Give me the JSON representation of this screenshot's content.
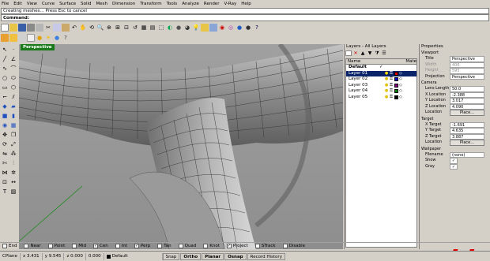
{
  "menu": [
    "File",
    "Edit",
    "View",
    "Curve",
    "Surface",
    "Solid",
    "Mesh",
    "Dimension",
    "Transform",
    "Tools",
    "Analyze",
    "Render",
    "V-Ray",
    "Help"
  ],
  "command": {
    "history": "Creating meshes... Press Esc to cancel",
    "prompt": "Command:"
  },
  "viewport": {
    "label": "Perspective",
    "overlay_number": "77"
  },
  "layers": {
    "title": "Layers - All Layers",
    "columns": {
      "name": "Name",
      "material": "Mate"
    },
    "items": [
      {
        "name": "Default",
        "current": true,
        "color": "#000000"
      },
      {
        "name": "Layer 01",
        "current": false,
        "color": "#e00000",
        "selected": true
      },
      {
        "name": "Layer 02",
        "current": false,
        "color": "#0000cc"
      },
      {
        "name": "Layer 03",
        "current": false,
        "color": "#800080"
      },
      {
        "name": "Layer 04",
        "current": false,
        "color": "#008000"
      },
      {
        "name": "Layer 05",
        "current": false,
        "color": "#000000"
      }
    ]
  },
  "properties": {
    "title": "Properties",
    "section_viewport": "Viewport",
    "title_label": "Title",
    "title_value": "Perspective",
    "width_label": "Width",
    "width_value": "406",
    "height_label": "Height",
    "height_value": "595",
    "projection_label": "Projection",
    "projection_value": "Perspective",
    "section_camera": "Camera",
    "lens_label": "Lens Length",
    "lens_value": "50.0",
    "xloc_label": "X Location",
    "xloc_value": "-2.388",
    "yloc_label": "Y Location",
    "yloc_value": "3.017",
    "zloc_label": "Z Location",
    "zloc_value": "4.090",
    "location_label": "Location",
    "place_label": "Place...",
    "section_target": "Target",
    "xt_label": "X Target",
    "xt_value": "-1.691",
    "yt_label": "Y Target",
    "yt_value": "4.635",
    "zt_label": "Z Target",
    "zt_value": "3.887",
    "tlocation_label": "Location",
    "tplace_label": "Place...",
    "section_wallpaper": "Wallpaper",
    "filename_label": "Filename",
    "filename_value": "(none)",
    "show_label": "Show",
    "gray_label": "Gray"
  },
  "osnap": [
    {
      "label": "End",
      "checked": false
    },
    {
      "label": "Near",
      "checked": false
    },
    {
      "label": "Point",
      "checked": false
    },
    {
      "label": "Mid",
      "checked": false
    },
    {
      "label": "Cen",
      "checked": true
    },
    {
      "label": "Int",
      "checked": false
    },
    {
      "label": "Perp",
      "checked": true
    },
    {
      "label": "Tan",
      "checked": false
    },
    {
      "label": "Quad",
      "checked": false
    },
    {
      "label": "Knot",
      "checked": false
    },
    {
      "label": "Project",
      "checked": true
    },
    {
      "label": "STrack",
      "checked": false
    },
    {
      "label": "Disable",
      "checked": false
    }
  ],
  "status": {
    "cplane": "CPlane",
    "x": "x 3.431",
    "y": "y 9.545",
    "z": "z 0.000",
    "dist": "0.000",
    "layer": "Default",
    "panes": [
      {
        "label": "Snap",
        "on": false
      },
      {
        "label": "Ortho",
        "on": true
      },
      {
        "label": "Planar",
        "on": true
      },
      {
        "label": "Osnap",
        "on": true
      },
      {
        "label": "Record History",
        "on": false
      }
    ]
  }
}
